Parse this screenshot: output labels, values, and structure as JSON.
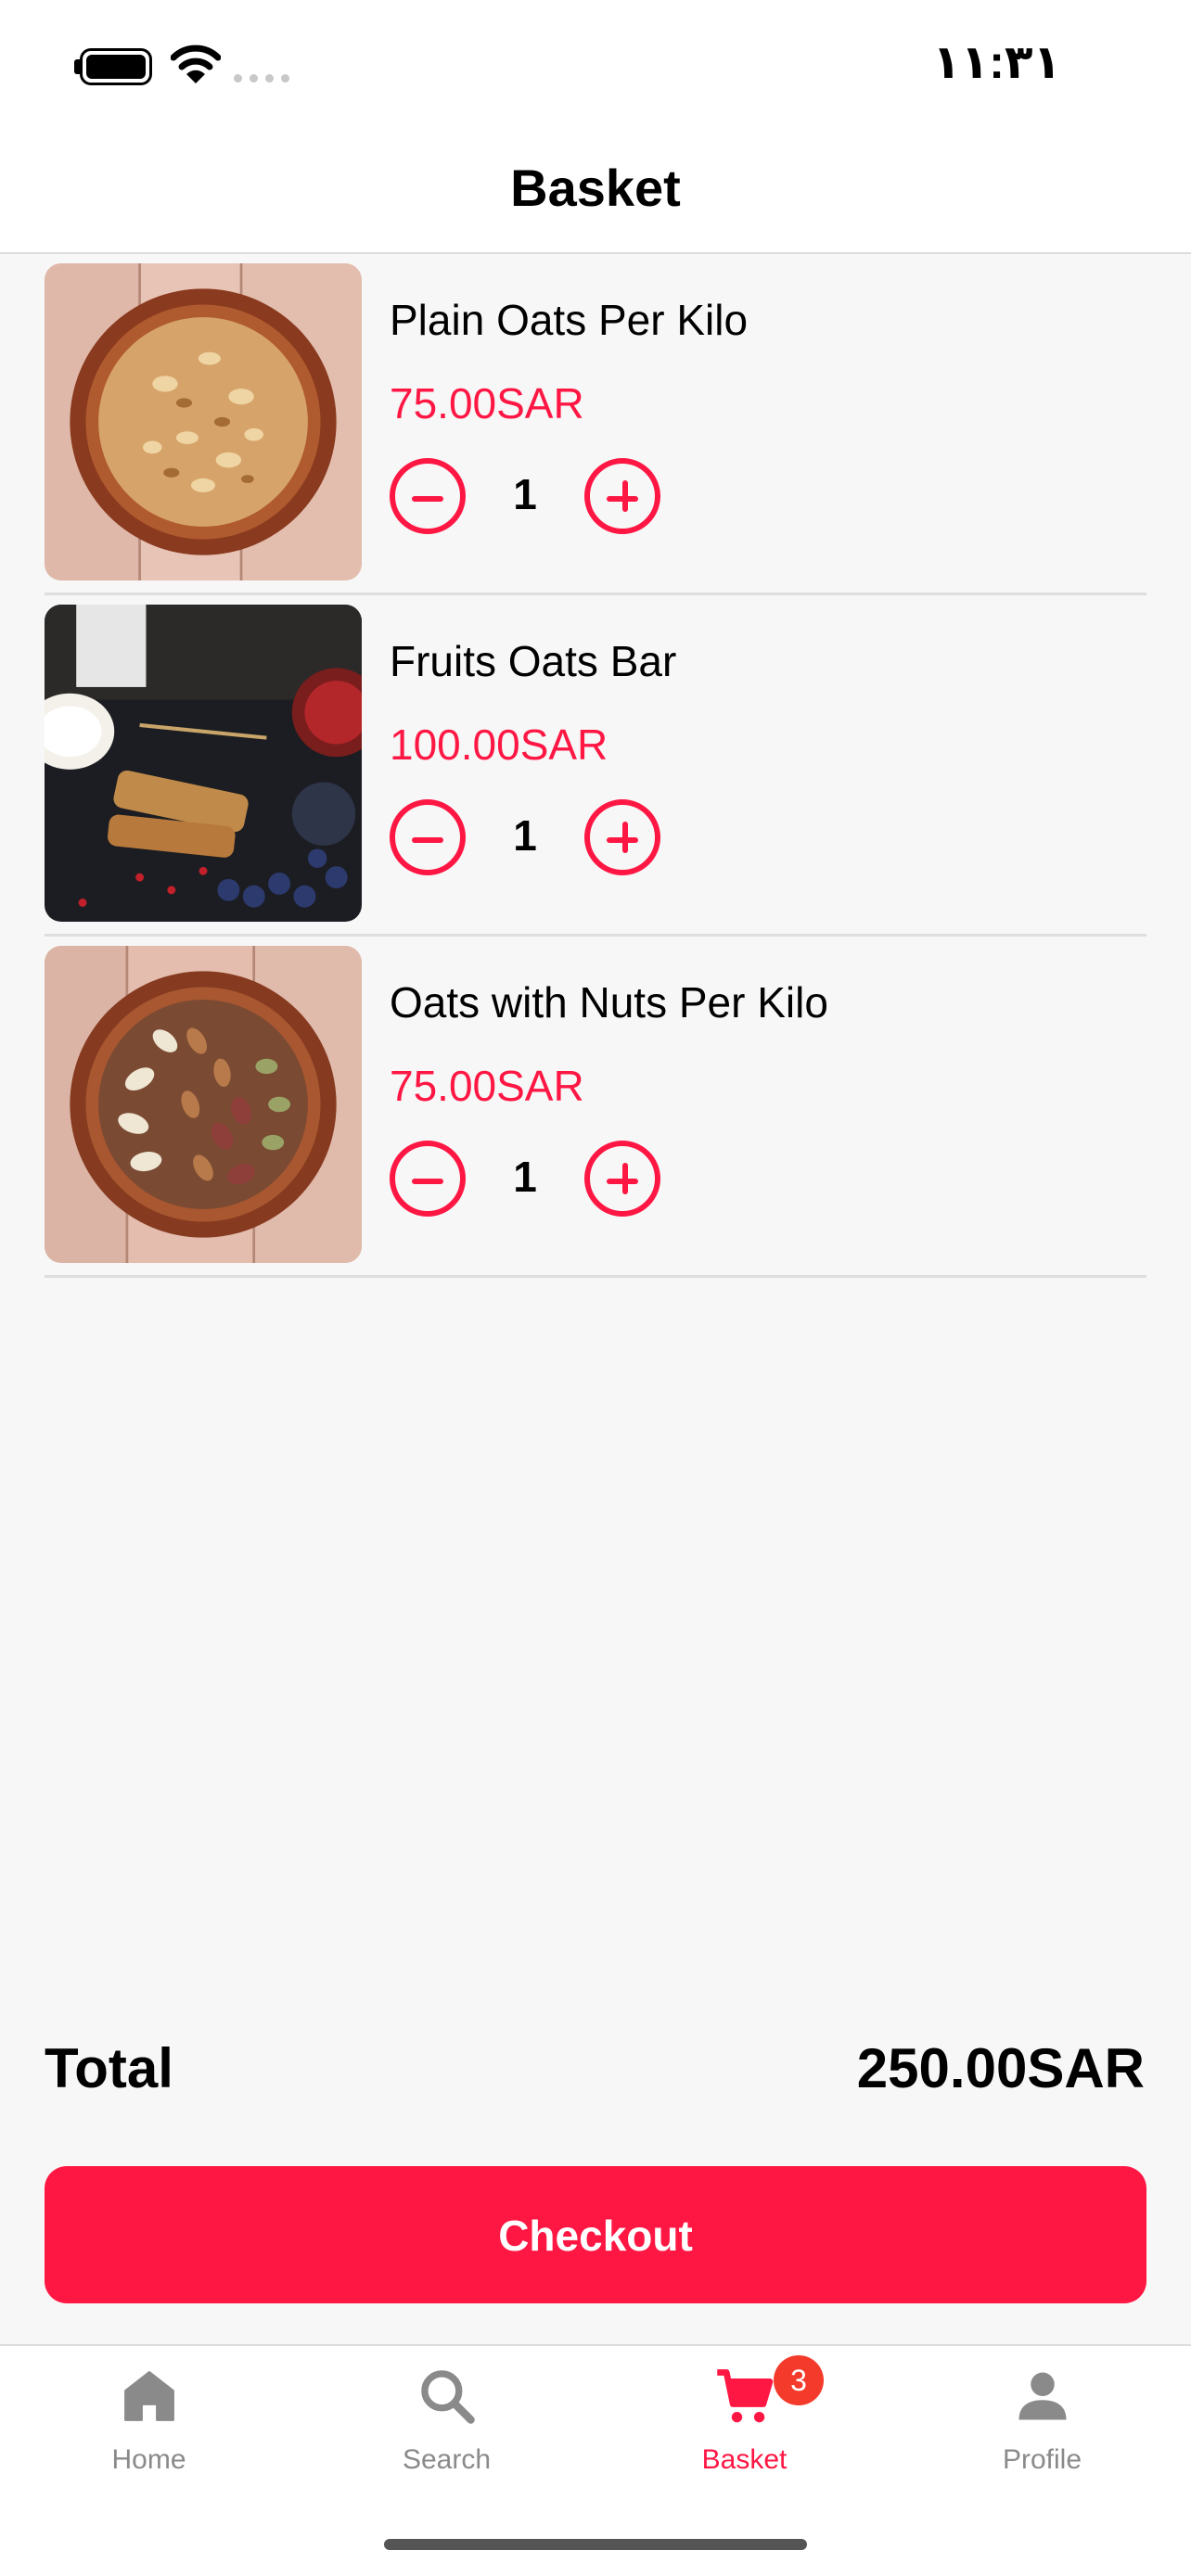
{
  "status_bar": {
    "time": "١١:٣١"
  },
  "header": {
    "title": "Basket"
  },
  "items": [
    {
      "name": "Plain Oats Per Kilo",
      "price": "75.00SAR",
      "quantity": "1"
    },
    {
      "name": "Fruits Oats Bar",
      "price": "100.00SAR",
      "quantity": "1"
    },
    {
      "name": "Oats with Nuts Per Kilo",
      "price": "75.00SAR",
      "quantity": "1"
    }
  ],
  "summary": {
    "total_label": "Total",
    "total_value": "250.00SAR"
  },
  "checkout": {
    "label": "Checkout"
  },
  "tabbar": {
    "tabs": [
      {
        "label": "Home",
        "icon": "home-icon"
      },
      {
        "label": "Search",
        "icon": "search-icon"
      },
      {
        "label": "Basket",
        "icon": "cart-icon",
        "badge": "3",
        "active": true
      },
      {
        "label": "Profile",
        "icon": "person-icon"
      }
    ]
  },
  "colors": {
    "accent": "#ff1744",
    "badge": "#f43a2a",
    "inactive": "#8a8a8a"
  }
}
